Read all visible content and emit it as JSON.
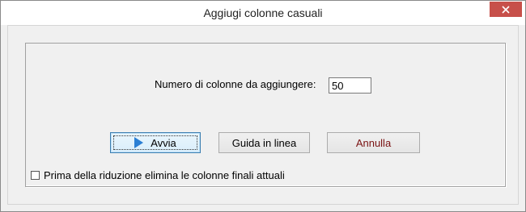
{
  "window": {
    "title": "Aggiugi colonne casuali"
  },
  "form": {
    "count_label": "Numero di colonne da aggiungere:",
    "count_value": "50"
  },
  "buttons": {
    "start_label": "Avvia",
    "help_label": "Guida in linea",
    "cancel_label": "Annulla"
  },
  "options": {
    "remove_last_columns_label": "Prima della riduzione elimina le colonne finali attuali",
    "remove_last_columns_checked": false
  },
  "icons": {
    "start": "play-icon",
    "close": "close-icon"
  },
  "colors": {
    "close_button": "#c7504a",
    "play_icon": "#2b7fd4",
    "cancel_text": "#7a1313"
  }
}
